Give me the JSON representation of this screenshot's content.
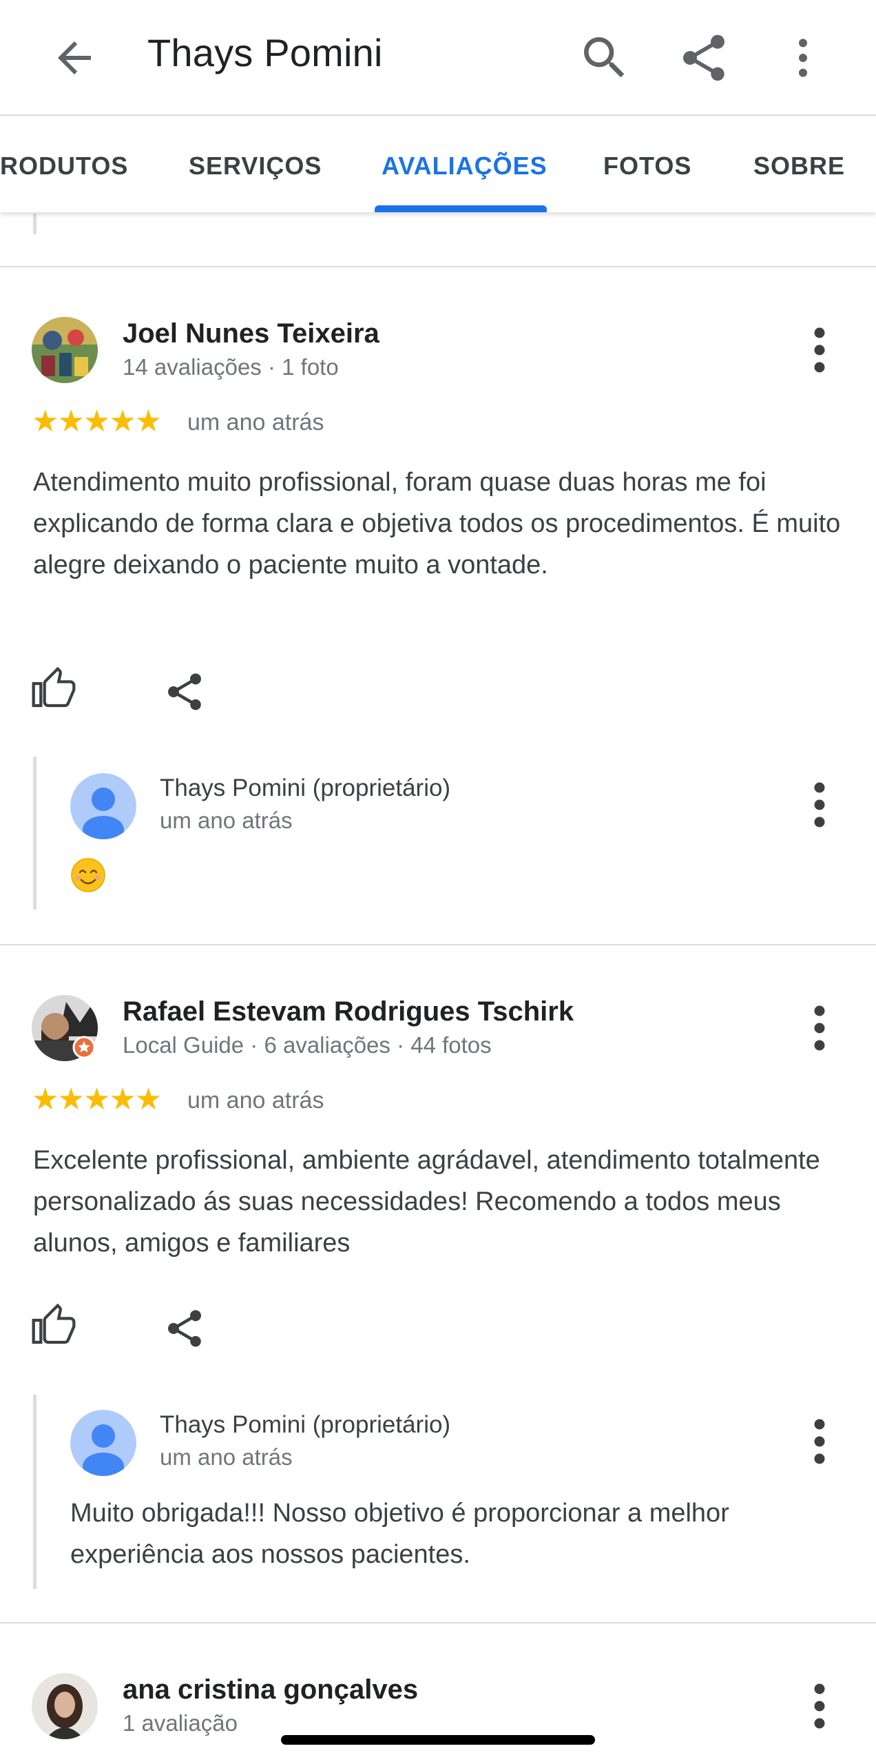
{
  "header": {
    "title": "Thays Pomini"
  },
  "tabs": [
    "RODUTOS",
    "SERVIÇOS",
    "AVALIAÇÕES",
    "FOTOS",
    "SOBRE"
  ],
  "reviews": [
    {
      "author": "Joel Nunes Teixeira",
      "meta": "14 avaliações · 1 foto",
      "rating": 5,
      "stars": "★★★★★",
      "date": "um ano atrás",
      "text": "Atendimento muito profissional, foram quase duas horas me foi explicando de forma clara e objetiva todos os procedimentos. É muito alegre deixando o paciente muito a vontade.",
      "reply": {
        "author": "Thays Pomini (proprietário)",
        "date": "um ano atrás",
        "text": "😊"
      }
    },
    {
      "author": "Rafael Estevam Rodrigues Tschirk",
      "meta": "Local Guide · 6 avaliações · 44 fotos",
      "rating": 5,
      "stars": "★★★★★",
      "date": "um ano atrás",
      "text": "Excelente profissional, ambiente agrádavel, atendimento totalmente personalizado ás suas necessidades! Recomendo a todos meus alunos, amigos e familiares",
      "reply": {
        "author": "Thays Pomini (proprietário)",
        "date": "um ano atrás",
        "text": "Muito obrigada!!! Nosso objetivo é proporcionar a melhor experiência aos nossos pacientes."
      }
    },
    {
      "author": "ana cristina gonçalves",
      "meta": "1 avaliação"
    }
  ],
  "colors": {
    "accent": "#1a73e8",
    "star": "#fbbc04",
    "muted": "#70757a"
  }
}
